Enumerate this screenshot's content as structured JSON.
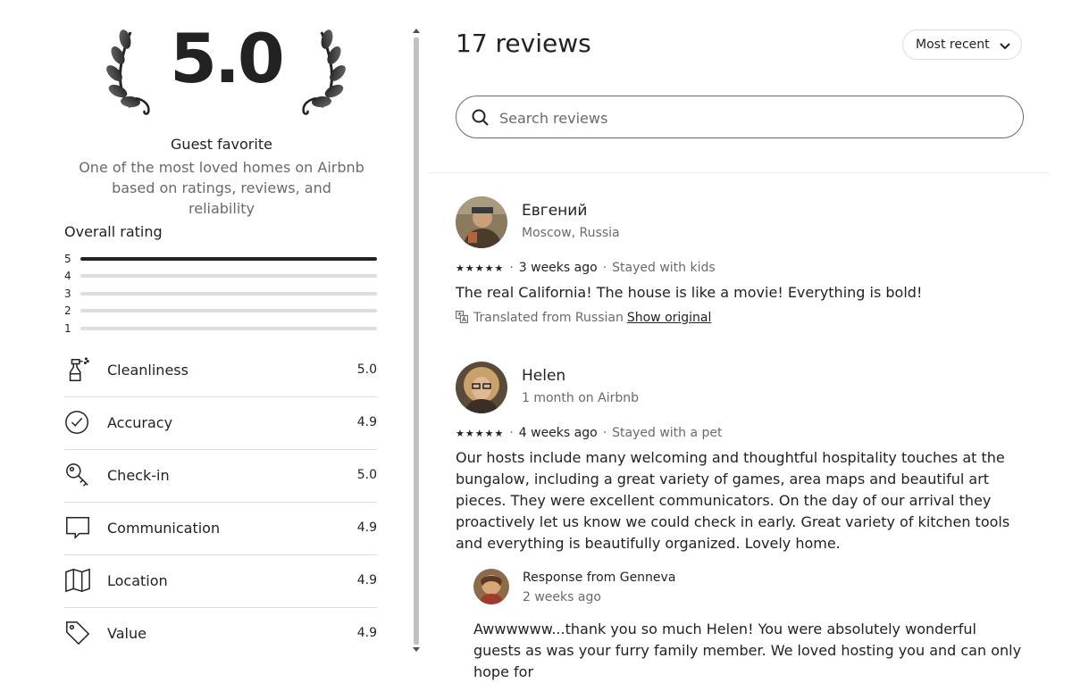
{
  "summary": {
    "score": "5.0",
    "guest_favorite": "Guest favorite",
    "description": "One of the most loved homes on Airbnb based on ratings, reviews, and reliability"
  },
  "overall": {
    "title": "Overall rating",
    "bars": [
      {
        "label": "5",
        "fraction": 1.0
      },
      {
        "label": "4",
        "fraction": 0.0
      },
      {
        "label": "3",
        "fraction": 0.0
      },
      {
        "label": "2",
        "fraction": 0.0
      },
      {
        "label": "1",
        "fraction": 0.0
      }
    ]
  },
  "categories": [
    {
      "label": "Cleanliness",
      "value": "5.0",
      "icon": "spray-bottle-icon"
    },
    {
      "label": "Accuracy",
      "value": "4.9",
      "icon": "check-circle-icon"
    },
    {
      "label": "Check-in",
      "value": "5.0",
      "icon": "key-icon"
    },
    {
      "label": "Communication",
      "value": "4.9",
      "icon": "chat-bubble-icon"
    },
    {
      "label": "Location",
      "value": "4.9",
      "icon": "map-icon"
    },
    {
      "label": "Value",
      "value": "4.9",
      "icon": "price-tag-icon"
    }
  ],
  "reviews_panel": {
    "title": "17 reviews",
    "sort_label": "Most recent",
    "search_placeholder": "Search reviews"
  },
  "reviews": [
    {
      "name": "Евгений",
      "subtitle": "Moscow, Russia",
      "stars": "★★★★★",
      "date": "3 weeks ago",
      "stay": "Stayed with kids",
      "text": "The real California! The house is like a movie! Everything is bold!",
      "translated_note": "Translated from Russian",
      "show_original": "Show original"
    },
    {
      "name": "Helen",
      "subtitle": "1 month on Airbnb",
      "stars": "★★★★★",
      "date": "4 weeks ago",
      "stay": "Stayed with a pet",
      "text": "Our hosts include many welcoming and thoughtful hospitality touches at the bungalow, including a great variety of games, area maps and beautiful art pieces. They were excellent communicators. On the day of our arrival they proactively let us know we could check in early. Great variety of kitchen tools and everything is beautifully organized. Lovely home.",
      "response": {
        "title": "Response from Genneva",
        "date": "2 weeks ago",
        "text": "Awwwwww...thank you so much Helen! You were absolutely wonderful guests as was your furry family member. We loved hosting you and can only hope for"
      }
    }
  ],
  "colors": {
    "text": "#222222",
    "muted": "#6a6a6a",
    "border": "#dddddd"
  }
}
